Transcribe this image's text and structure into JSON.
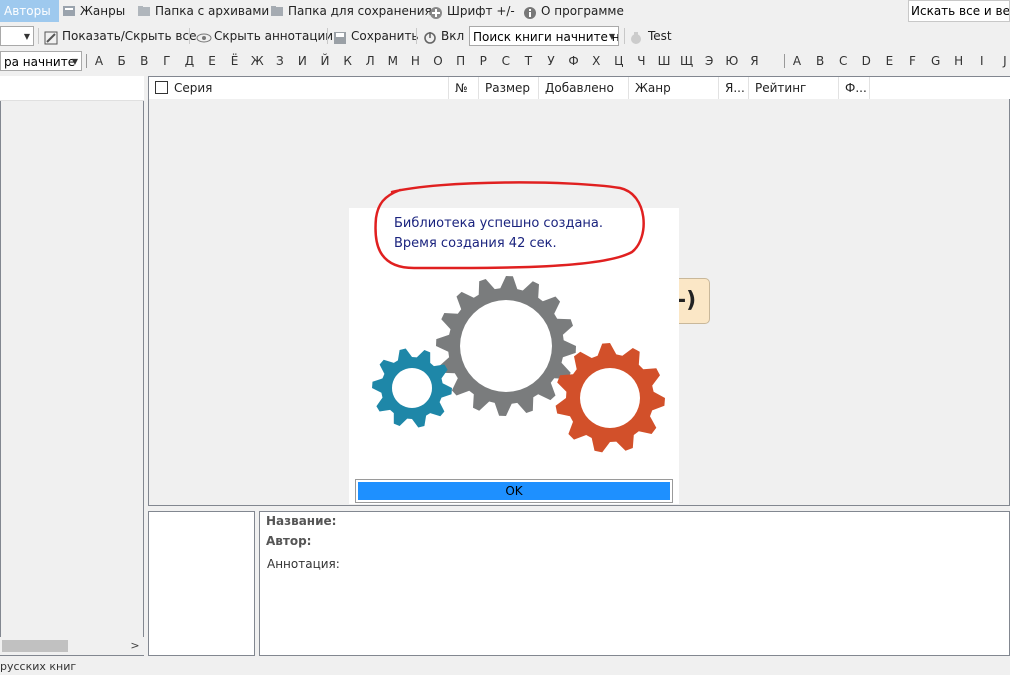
{
  "menu": {
    "authors": "Авторы",
    "genres": "Жанры",
    "archives_folder": "Папка с архивами",
    "save_folder": "Папка для сохранения",
    "font": "Шрифт +/-",
    "about": "О программе",
    "search_everywhere": "Искать все и везд"
  },
  "toolbar": {
    "show_hide_all": "Показать/Скрыть все",
    "hide_annotations": "Скрыть аннотации",
    "save": "Сохранить",
    "on": "Вкл",
    "book_search_placeholder": "Поиск книги начните н",
    "test": "Test",
    "left_combo_text": "ра начните"
  },
  "alphabet": {
    "cyrillic": [
      "А",
      "Б",
      "В",
      "Г",
      "Д",
      "Е",
      "Ё",
      "Ж",
      "З",
      "И",
      "Й",
      "К",
      "Л",
      "М",
      "Н",
      "О",
      "П",
      "Р",
      "С",
      "Т",
      "У",
      "Ф",
      "Х",
      "Ц",
      "Ч",
      "Ш",
      "Щ",
      "Э",
      "Ю",
      "Я"
    ],
    "latin": [
      "A",
      "B",
      "C",
      "D",
      "E",
      "F",
      "G",
      "H",
      "I",
      "J"
    ]
  },
  "table": {
    "columns": [
      "Серия",
      "№",
      "Размер",
      "Добавлено",
      "Жанр",
      "Я...",
      "Рейтинг",
      "Ф..."
    ]
  },
  "details": {
    "title_label": "Название:",
    "author_label": "Автор:",
    "annotation_label": "Аннотация:"
  },
  "status": {
    "text": "русских книг"
  },
  "background_badge": "-)",
  "dialog": {
    "message_line1": "Библиотека успешно создана.",
    "message_line2": "Время создания 42 сек.",
    "ok_label": "OK"
  },
  "colors": {
    "gear_gray": "#7a7c7d",
    "gear_blue": "#1e87a8",
    "gear_orange": "#d2502a",
    "ok_blue": "#1e90ff",
    "annotation_red": "#e02020",
    "message_blue": "#1a237e"
  }
}
